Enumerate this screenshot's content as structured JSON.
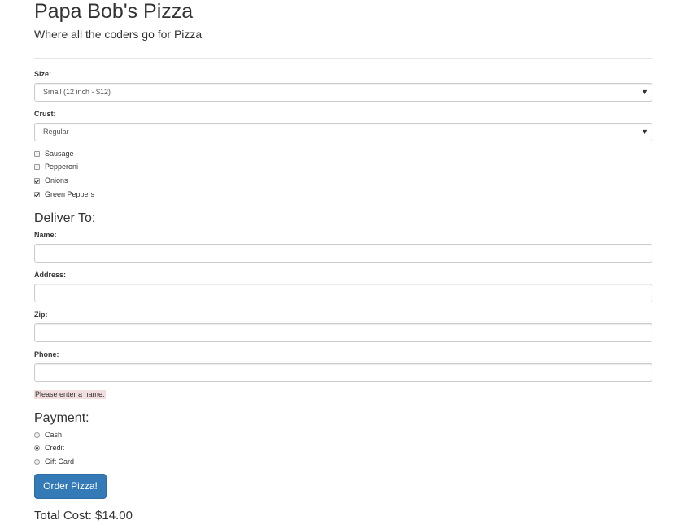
{
  "header": {
    "title": "Papa Bob's Pizza",
    "subtitle": "Where all the coders go for Pizza"
  },
  "order": {
    "size": {
      "label": "Size:",
      "selected": "Small (12 inch - $12)"
    },
    "crust": {
      "label": "Crust:",
      "selected": "Regular"
    },
    "toppings": [
      {
        "label": "Sausage",
        "checked": false
      },
      {
        "label": "Pepperoni",
        "checked": false
      },
      {
        "label": "Onions",
        "checked": true
      },
      {
        "label": "Green Peppers",
        "checked": true
      }
    ]
  },
  "delivery": {
    "heading": "Deliver To:",
    "name_label": "Name:",
    "name_value": "",
    "address_label": "Address:",
    "address_value": "",
    "zip_label": "Zip:",
    "zip_value": "",
    "phone_label": "Phone:",
    "phone_value": "",
    "validation_message": "Please enter a name."
  },
  "payment": {
    "heading": "Payment:",
    "options": [
      {
        "label": "Cash",
        "selected": false
      },
      {
        "label": "Credit",
        "selected": true
      },
      {
        "label": "Gift Card",
        "selected": false
      }
    ]
  },
  "actions": {
    "order_button": "Order Pizza!"
  },
  "summary": {
    "total_cost": "Total Cost: $14.00"
  },
  "icons": {
    "dropdown_arrow": "▼"
  },
  "colors": {
    "primary_button": "#337ab7",
    "validation_background": "#f2dede"
  }
}
